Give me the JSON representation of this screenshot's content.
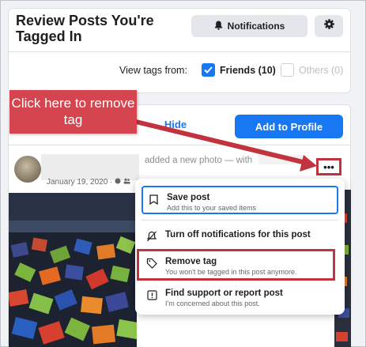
{
  "header": {
    "title": "Review Posts You're Tagged In",
    "notifications_label": "Notifications",
    "view_tags_label": "View tags from:",
    "friends_label": "Friends (10)",
    "others_label": "Others (0)"
  },
  "post": {
    "hide_label": "Hide",
    "add_to_profile_label": "Add to Profile",
    "activity_text": "added a new photo — with",
    "date": "January 19, 2020 ·",
    "more_label": "•••"
  },
  "menu": {
    "items": [
      {
        "title": "Save post",
        "subtitle": "Add this to your saved items",
        "icon": "bookmark-icon"
      },
      {
        "title": "Turn off notifications for this post",
        "subtitle": "",
        "icon": "bell-off-icon"
      },
      {
        "title": "Remove tag",
        "subtitle": "You won't be tagged in this post anymore.",
        "icon": "tag-icon"
      },
      {
        "title": "Find support or report post",
        "subtitle": "I'm concerned about this post.",
        "icon": "report-icon"
      }
    ]
  },
  "annotation": {
    "callout_text": "Click here to remove tag"
  },
  "colors": {
    "accent": "#1877f2",
    "callout": "#d44550",
    "highlight": "#c0333f"
  }
}
